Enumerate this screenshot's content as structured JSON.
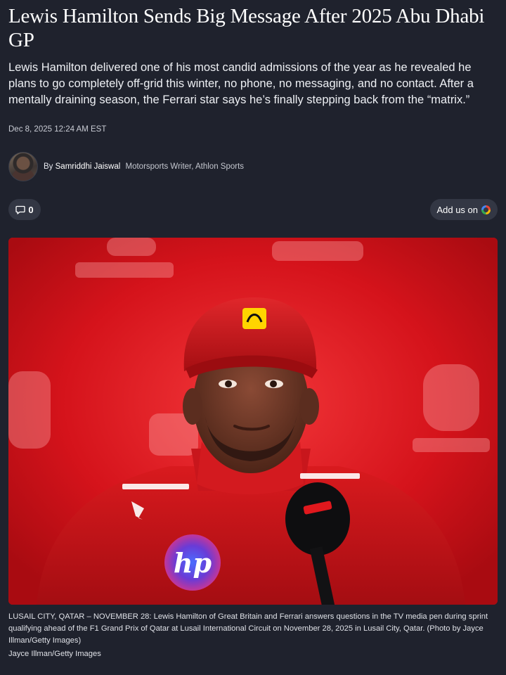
{
  "article": {
    "headline": "Lewis Hamilton Sends Big Message After 2025 Abu Dhabi GP",
    "dek": "Lewis Hamilton delivered one of his most candid admissions of the year as he revealed he plans to go completely off-grid this winter, no phone, no messaging, and no contact. After a mentally draining season, the Ferrari star says he’s finally stepping back from the “matrix.”",
    "date": "Dec 8, 2025 12:24 AM EST"
  },
  "byline": {
    "prefix": "By",
    "author": "Samriddhi Jaiswal",
    "role": "Motorsports Writer, Athlon Sports"
  },
  "actions": {
    "comment_count": "0",
    "add_google_label": "Add us on"
  },
  "hero": {
    "background_color": "#d8141a",
    "caption": "LUSAIL CITY, QATAR – NOVEMBER 28: Lewis Hamilton of Great Britain and Ferrari answers questions in the TV media pen during sprint qualifying ahead of the F1 Grand Prix of Qatar at Lusail International Circuit on November 28, 2025 in Lusail City, Qatar. (Photo by Jayce Illman/Getty Images)",
    "credit": "Jayce Illman/Getty Images"
  },
  "icons": {
    "comment": "comment-bubble-icon",
    "google": "google-g-icon",
    "avatar": "author-avatar"
  }
}
